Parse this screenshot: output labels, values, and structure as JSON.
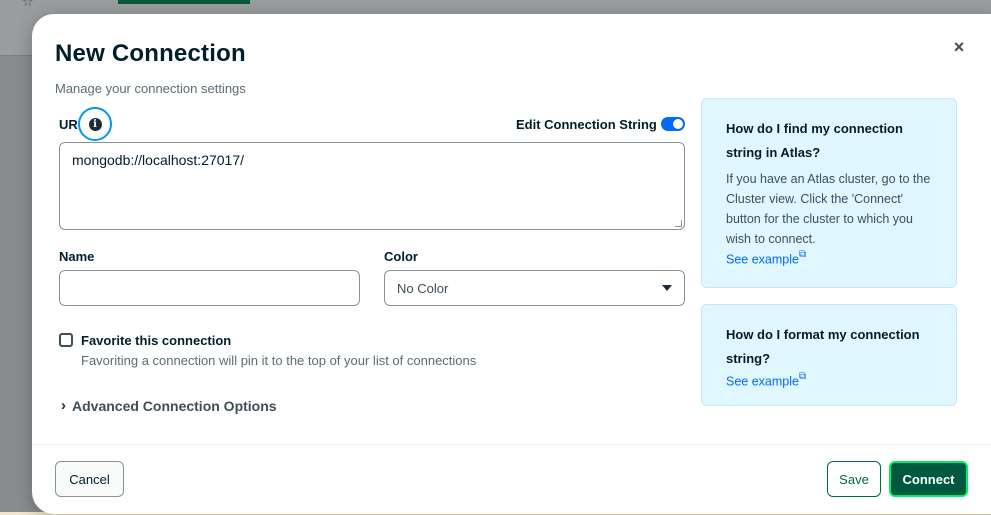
{
  "modal": {
    "title": "New Connection",
    "subtitle": "Manage your connection settings",
    "close_icon": "×"
  },
  "uri": {
    "label": "UR",
    "info_icon": "i",
    "edit_toggle_label": "Edit Connection String",
    "edit_toggle_on": true,
    "value": "mongodb://localhost:27017/"
  },
  "fields": {
    "name_label": "Name",
    "name_value": "",
    "color_label": "Color",
    "color_value": "No Color"
  },
  "favorite": {
    "checked": false,
    "label": "Favorite this connection",
    "description": "Favoriting a connection will pin it to the top of your list of connections"
  },
  "advanced": {
    "label": "Advanced Connection Options"
  },
  "help": [
    {
      "question": "How do I find my connection string in Atlas?",
      "text": "If you have an Atlas cluster, go to the Cluster view. Click the 'Connect' button for the cluster to which you wish to connect.",
      "link": "See example"
    },
    {
      "question": "How do I format my connection string?",
      "link": "See example"
    }
  ],
  "footer": {
    "cancel": "Cancel",
    "save": "Save",
    "connect": "Connect"
  },
  "colors": {
    "accent_blue": "#016bf8",
    "primary_green": "#00593f",
    "highlight_green": "#00ed64",
    "help_bg": "#e1f7ff"
  }
}
